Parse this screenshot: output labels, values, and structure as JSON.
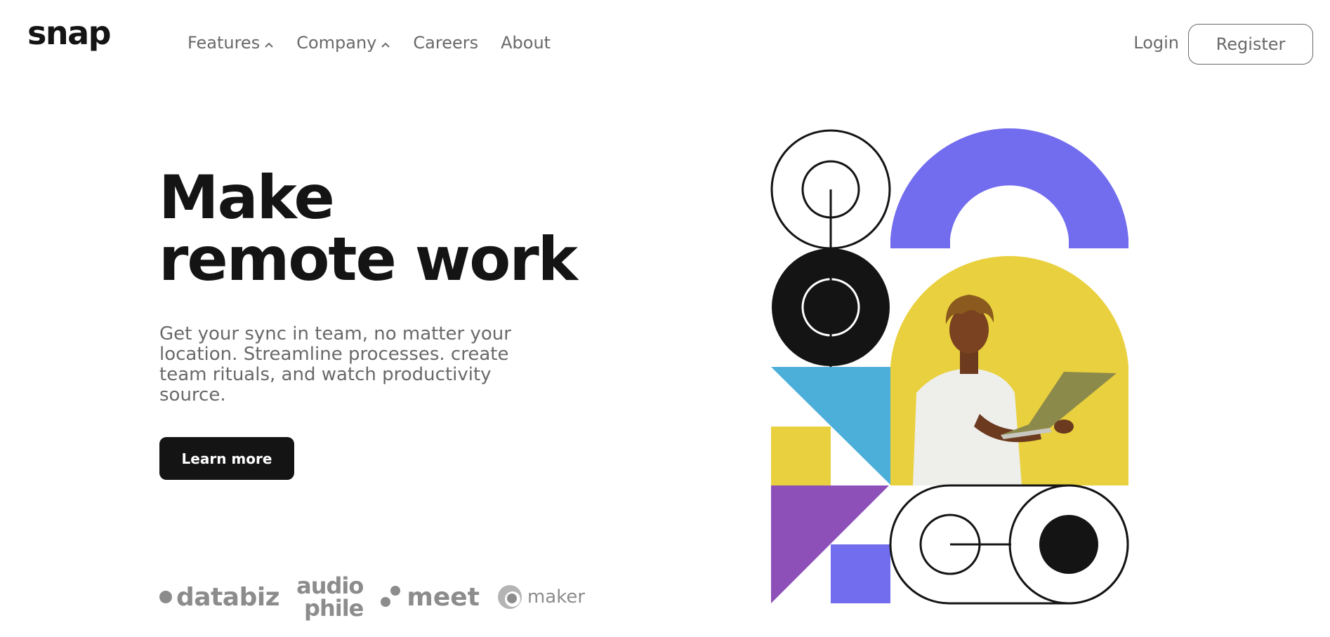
{
  "header": {
    "logo": "snap",
    "nav": [
      {
        "label": "Features",
        "has_dropdown": true
      },
      {
        "label": "Company",
        "has_dropdown": true
      },
      {
        "label": "Careers",
        "has_dropdown": false
      },
      {
        "label": "About",
        "has_dropdown": false
      }
    ],
    "login_label": "Login",
    "register_label": "Register"
  },
  "hero": {
    "title_line1": "Make",
    "title_line2": "remote work",
    "description": "Get your sync in team, no matter your location. Streamline processes. create team rituals, and watch productivity source.",
    "cta_label": "Learn more"
  },
  "clients": {
    "databiz": "databiz",
    "audiophile_line1": "audio",
    "audiophile_line2": "phile",
    "meet": "meet",
    "maker": "maker"
  },
  "colors": {
    "dark": "#141414",
    "gray": "#696969",
    "purple_blue": "#726CEE",
    "yellow": "#E9D03E",
    "cyan": "#4BAFDA",
    "violet": "#8D4FB8"
  }
}
